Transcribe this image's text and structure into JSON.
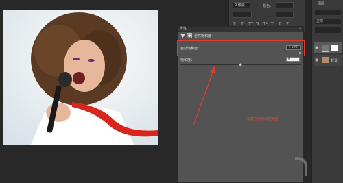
{
  "top_panel": {
    "preset_value": "0 像素",
    "right_label": "颜色：",
    "glyphs": [
      "T",
      "T",
      "TT",
      "Tr",
      "T¹",
      "T,",
      "T",
      "Ŧ"
    ]
  },
  "properties": {
    "tab_title": "属性",
    "close_glyph": "»",
    "header_title": "自然饱和度",
    "vibrance_label": "自然饱和度：",
    "vibrance_value": "+100",
    "saturation_label": "饱和度：",
    "saturation_value": "0"
  },
  "layers": {
    "tab_label": "图层",
    "kind_label": "正常",
    "row_label": "背景"
  },
  "annotation": {
    "note_text": "提高自然饱和度数值",
    "highlight_color": "#e23b2e"
  }
}
